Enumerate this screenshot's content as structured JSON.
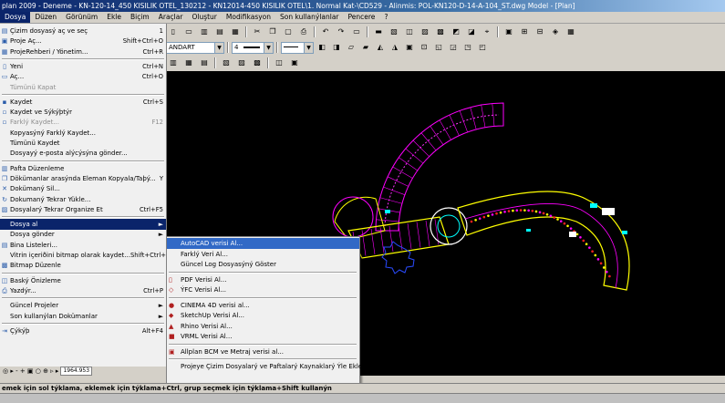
{
  "window": {
    "title": "plan 2009 - Deneme - KN-120-14_450 KISILIK OTEL_130212 - KN12014-450 KISILIK OTEL\\1. Normal Kat-\\CD529 - Alinmis: POL-KN120-D-14-A-104_ST.dwg Model - [Plan]"
  },
  "menubar": [
    "Dosya",
    "Düzen",
    "Görünüm",
    "Ekle",
    "Biçim",
    "Araçlar",
    "Oluştur",
    "Modifikasyon",
    "Son kullanýlanlar",
    "Pencere",
    "?"
  ],
  "toolbar": {
    "linetype_value": "ANDART",
    "pen_value": "4"
  },
  "dosya_menu": [
    {
      "label": "Çizim dosyasý aç ve seç",
      "shortcut": "1",
      "icon": "open-icon"
    },
    {
      "label": "Proje Aç...",
      "shortcut": "Shift+Ctrl+O",
      "icon": "project-icon"
    },
    {
      "label": "ProjeRehberi / Yönetim...",
      "shortcut": "Ctrl+R",
      "icon": "manager-icon"
    },
    {
      "sep": true
    },
    {
      "label": "Yeni",
      "shortcut": "Ctrl+N",
      "icon": "new-icon"
    },
    {
      "label": "Aç...",
      "shortcut": "Ctrl+O",
      "icon": "folder-icon"
    },
    {
      "label": "Tümünü Kapat",
      "shortcut": "",
      "disabled": true
    },
    {
      "sep": true
    },
    {
      "label": "Kaydet",
      "shortcut": "Ctrl+S",
      "icon": "save-icon"
    },
    {
      "label": "Kaydet ve Sýkýþtýr",
      "shortcut": "",
      "icon": "save-compress-icon"
    },
    {
      "label": "Farklý Kaydet...",
      "shortcut": "F12",
      "disabled": true,
      "icon": "save-as-icon"
    },
    {
      "label": "Kopyasýný Farklý Kaydet...",
      "shortcut": ""
    },
    {
      "label": "Tümünü Kaydet",
      "shortcut": ""
    },
    {
      "label": "Dosyayý e-posta alýcýsýna gönder...",
      "shortcut": ""
    },
    {
      "sep": true
    },
    {
      "label": "Pafta Düzenleme",
      "shortcut": "",
      "icon": "layout-icon"
    },
    {
      "label": "Dökümanlar arasýnda  Eleman Kopyala/Taþý...",
      "shortcut": "Y",
      "icon": "copy-icon"
    },
    {
      "label": "Dokümaný Sil...",
      "shortcut": "",
      "icon": "delete-icon"
    },
    {
      "label": "Dokumaný Tekrar Yükle...",
      "shortcut": "",
      "icon": "reload-icon"
    },
    {
      "label": "Dosyalarý Tekrar Organize Et",
      "shortcut": "Ctrl+F5",
      "icon": "reorganize-icon"
    },
    {
      "sep": true
    },
    {
      "label": "Dosya al",
      "shortcut": "►",
      "selected": true
    },
    {
      "label": "Dosya gönder",
      "shortcut": "►"
    },
    {
      "label": "Bina Listeleri...",
      "shortcut": "",
      "icon": "list-icon"
    },
    {
      "label": "Vitrin içeriðini bitmap olarak kaydet...",
      "shortcut": "Shift+Ctrl+S"
    },
    {
      "label": "Bitmap Düzenle",
      "shortcut": "",
      "icon": "bitmap-icon"
    },
    {
      "sep": true
    },
    {
      "label": "Baský Önizleme",
      "shortcut": "",
      "icon": "preview-icon"
    },
    {
      "label": "Yazdýr...",
      "shortcut": "Ctrl+P",
      "icon": "print-icon"
    },
    {
      "sep": true
    },
    {
      "label": "Güncel Projeler",
      "shortcut": "►"
    },
    {
      "label": "Son kullanýlan Dokümanlar",
      "shortcut": "►"
    },
    {
      "sep": true
    },
    {
      "label": "Çýkýþ",
      "shortcut": "Alt+F4",
      "icon": "exit-icon"
    }
  ],
  "dosya_al_submenu": [
    {
      "label": "AutoCAD verisi Al...",
      "selected": true
    },
    {
      "label": "Farklý Veri Al..."
    },
    {
      "label": "Güncel Log Dosyasýný Göster"
    },
    {
      "sep": true
    },
    {
      "label": "PDF Verisi Al...",
      "icon": "pdf-icon"
    },
    {
      "label": "ÝFC Verisi Al...",
      "icon": "ifc-icon"
    },
    {
      "sep": true
    },
    {
      "label": "CINEMA 4D verisi al...",
      "icon": "cinema4d-icon"
    },
    {
      "label": "SketchUp Verisi Al...",
      "icon": "sketchup-icon"
    },
    {
      "label": "Rhino Verisi Al...",
      "icon": "rhino-icon"
    },
    {
      "label": "VRML Verisi Al...",
      "icon": "vrml-icon"
    },
    {
      "sep": true
    },
    {
      "label": "Allplan BCM ve Metraj verisi al...",
      "icon": "bcm-icon"
    },
    {
      "sep": true
    },
    {
      "label": "Projeye Çizim Dosyalarý ve Paftalarý Kaynaklarý Ýle Ekle"
    }
  ],
  "bottom_input": {
    "value": "1964.953"
  },
  "statusbar": {
    "text": "emek için sol týklama, eklemek için týklama+Ctrl, grup seçmek için týklama+Shift kullanýn"
  },
  "colors": {
    "menu_highlight": "#0a246a",
    "submenu_highlight": "#3169c6",
    "canvas": "#000000"
  }
}
